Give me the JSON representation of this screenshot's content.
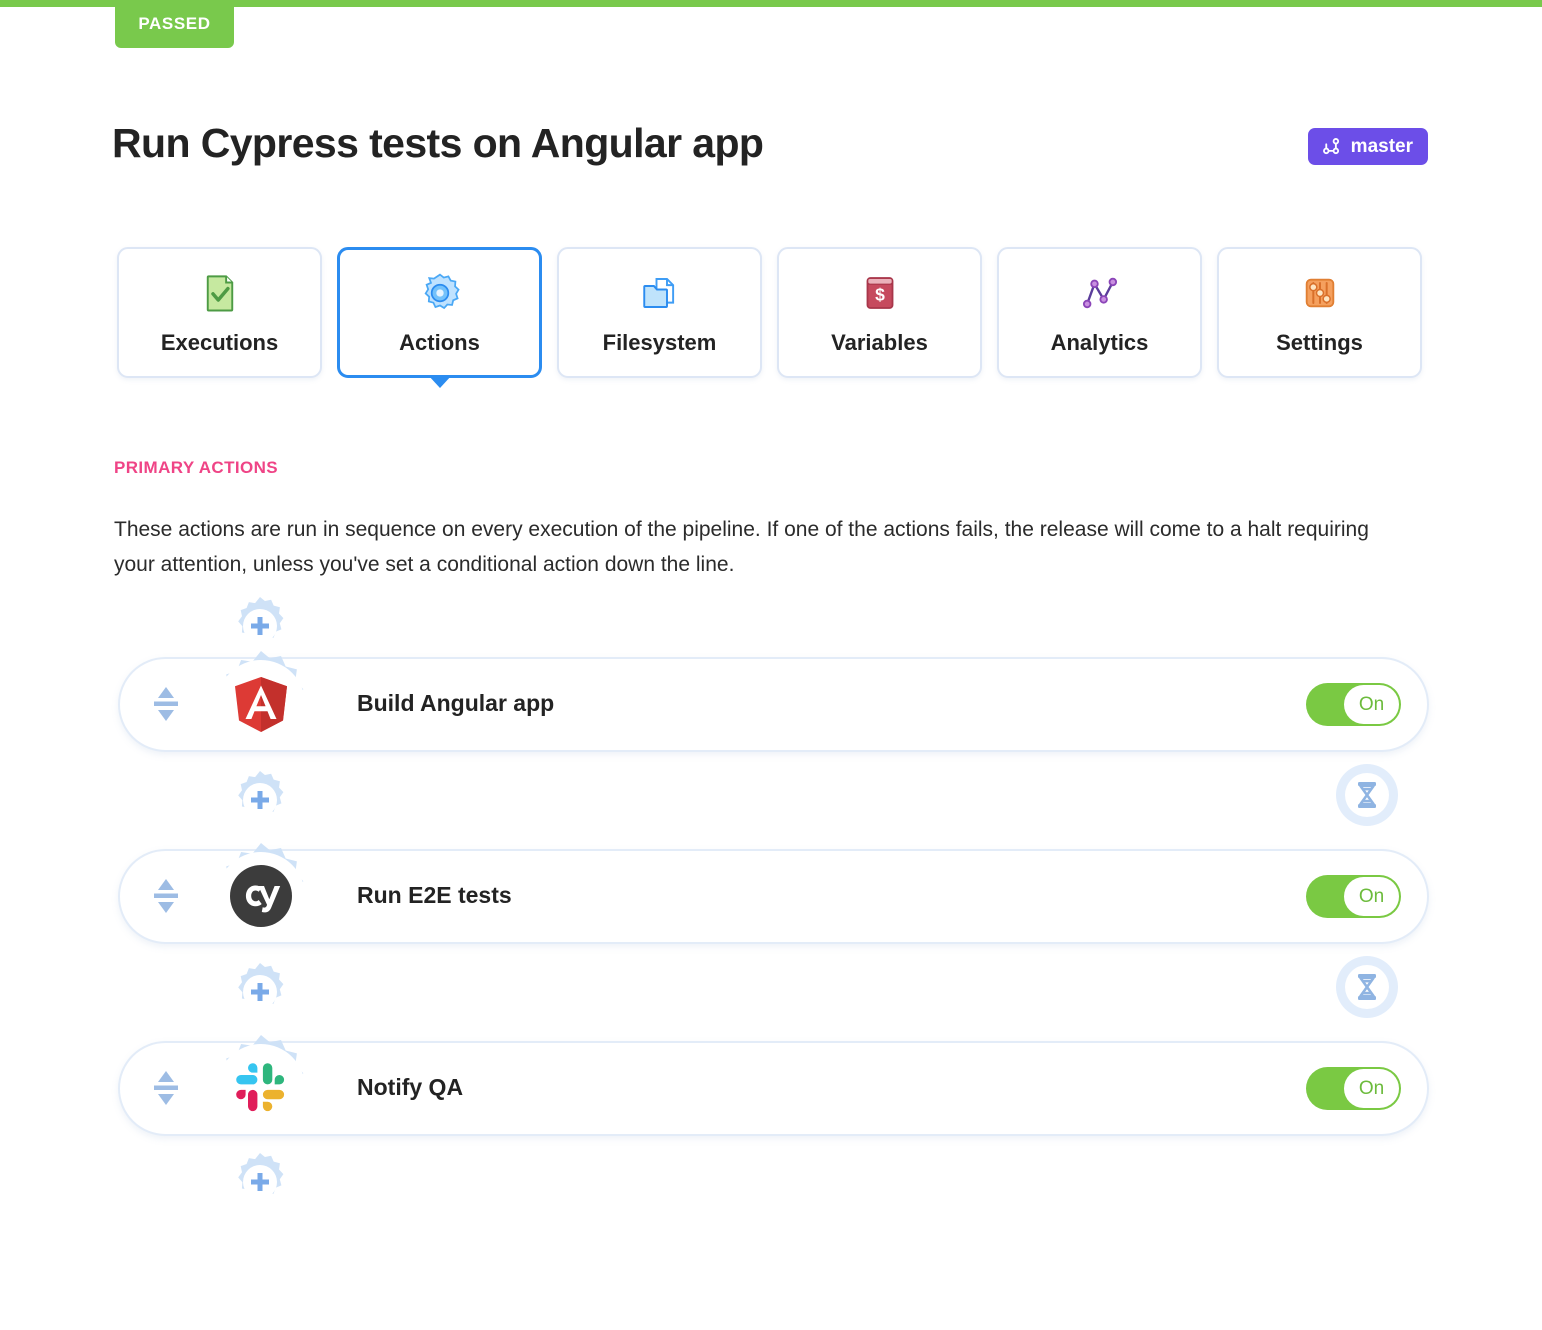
{
  "status": {
    "label": "PASSED",
    "color": "#79c94c"
  },
  "header": {
    "title": "Run Cypress tests on Angular app",
    "branch": "master",
    "branch_color": "#6c4ee8",
    "branch_icon": "git-branch-icon"
  },
  "tabs": [
    {
      "label": "Executions",
      "icon": "document-check-icon",
      "selected": false
    },
    {
      "label": "Actions",
      "icon": "gear-icon",
      "selected": true
    },
    {
      "label": "Filesystem",
      "icon": "folder-file-icon",
      "selected": false
    },
    {
      "label": "Variables",
      "icon": "terminal-dollar-icon",
      "selected": false
    },
    {
      "label": "Analytics",
      "icon": "line-chart-icon",
      "selected": false
    },
    {
      "label": "Settings",
      "icon": "sliders-icon",
      "selected": false
    }
  ],
  "section": {
    "title": "PRIMARY ACTIONS",
    "title_color": "#ef4486",
    "description": "These actions are run in sequence on every execution of the pipeline. If one of the actions fails, the release will come to a halt requiring your attention, unless you've set a conditional action down the line."
  },
  "actions": [
    {
      "name": "Build Angular app",
      "logo": "angular-logo-icon",
      "toggle": "On",
      "toggle_color": "#7ac943"
    },
    {
      "name": "Run E2E tests",
      "logo": "cypress-logo-icon",
      "toggle": "On",
      "toggle_color": "#7ac943"
    },
    {
      "name": "Notify QA",
      "logo": "slack-logo-icon",
      "toggle": "On",
      "toggle_color": "#7ac943"
    }
  ],
  "controls": {
    "add_action": "add-action-gear-icon",
    "wait": "hourglass-icon",
    "drag": "reorder-handle-icon"
  }
}
